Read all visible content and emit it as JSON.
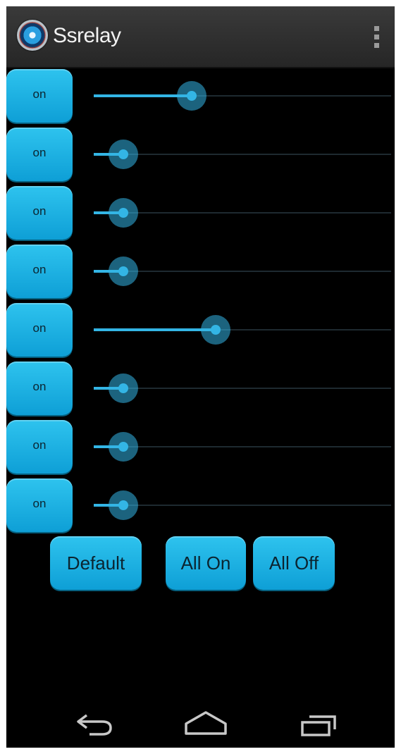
{
  "app": {
    "title": "Ssrelay",
    "icon": "ssrelay-app-icon"
  },
  "action_bar": {
    "overflow_icon": "overflow-menu-icon"
  },
  "relays": [
    {
      "button_label": "on",
      "level": 0.33
    },
    {
      "button_label": "on",
      "level": 0.1
    },
    {
      "button_label": "on",
      "level": 0.1
    },
    {
      "button_label": "on",
      "level": 0.1
    },
    {
      "button_label": "on",
      "level": 0.41
    },
    {
      "button_label": "on",
      "level": 0.1
    },
    {
      "button_label": "on",
      "level": 0.1
    },
    {
      "button_label": "on",
      "level": 0.1
    }
  ],
  "controls": {
    "default_label": "Default",
    "all_on_label": "All On",
    "all_off_label": "All Off"
  },
  "nav": {
    "back_icon": "back-icon",
    "home_icon": "home-icon",
    "recent_icon": "recent-apps-icon"
  },
  "colors": {
    "accent": "#33b5e5",
    "button": "#1ab0e3",
    "background": "#000000"
  }
}
